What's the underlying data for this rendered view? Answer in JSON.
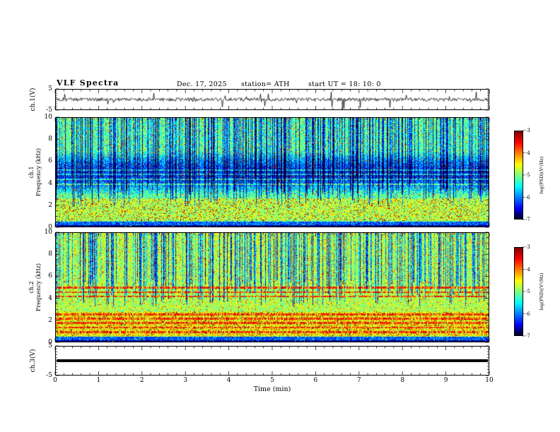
{
  "header": {
    "title": "VLF  Spectra",
    "date": "Dec. 17, 2025",
    "station": "station= ATH",
    "start_ut": "start UT  =   18: 10: 0"
  },
  "x_axis": {
    "label": "Time  (min)",
    "min": 0,
    "max": 10,
    "major_ticks": [
      0,
      1,
      2,
      3,
      4,
      5,
      6,
      7,
      8,
      9,
      10
    ],
    "minor_step": 0.2
  },
  "chart_data": [
    {
      "type": "line",
      "id": "ch1-waveform",
      "ylabel": "ch.1(V)",
      "ylim": [
        -5,
        5
      ],
      "ytick_labels": [
        5,
        -5
      ],
      "description": "Noisy channel-1 voltage trace, ~±1 V background with frequent impulsive sferic spikes reaching ±5 V",
      "seed": 7
    },
    {
      "type": "heatmap",
      "id": "ch1-spectrogram",
      "ylabel_lines": [
        "ch.1",
        "Frequency (kHz)"
      ],
      "ylim": [
        0,
        10
      ],
      "yticks": [
        0,
        2,
        4,
        6,
        8,
        10
      ],
      "colorbar": {
        "label": "log(PSD)(V²/Hz)",
        "ticks": [
          -3,
          -4,
          -5,
          -6,
          -7
        ],
        "min": -7,
        "max": -3
      },
      "features": {
        "background_psd": -4.9,
        "attenuation_band_khz": [
          2.9,
          6.9
        ],
        "vertical_sferic_streaks": "dense dark-blue vertical streaks spanning ~2-10 kHz",
        "dark_noise_floor_band_khz": [
          0,
          0.45
        ],
        "warm_band_khz": [
          0.5,
          2.6
        ],
        "faint_horizontal_lines_khz": [
          3.9,
          4.35,
          4.8,
          5.2
        ]
      },
      "seed": 11,
      "render": {
        "base": 0.47,
        "noise_amp": 0.3,
        "band_depth": 0.27,
        "streak_prob": 0.42,
        "streak_bot_min": 1.8,
        "streak_bot_rand": 2.8,
        "warm_amt": 0.1
      }
    },
    {
      "type": "heatmap",
      "id": "ch2-spectrogram",
      "ylabel_lines": [
        "ch.2",
        "Frequency (kHz)"
      ],
      "ylim": [
        0,
        10
      ],
      "yticks": [
        0,
        2,
        4,
        6,
        8,
        10
      ],
      "colorbar": {
        "label": "log(PSD)(V²/Hz)",
        "ticks": [
          -3,
          -4,
          -5,
          -6,
          -7
        ],
        "min": -7,
        "max": -3
      },
      "features": {
        "background_psd": -4.6,
        "vertical_sferic_streaks": "blue vertical streaks mostly above ~3.5 kHz",
        "hot_horizontal_lines_khz": [
          0.9,
          1.3,
          1.7,
          2.1,
          2.5,
          4.15,
          4.55,
          4.95
        ],
        "dark_noise_floor_band_khz": [
          0,
          0.45
        ],
        "warm_band_khz": [
          0.5,
          2.7
        ]
      },
      "seed": 23,
      "render": {
        "base": 0.56,
        "noise_amp": 0.28,
        "streak_prob": 0.36,
        "streak_bot_min": 3.2,
        "streak_bot_rand": 2.6,
        "warm_amt": 0.08
      }
    },
    {
      "type": "line",
      "id": "ch3-waveform",
      "ylabel": "ch.3(V)",
      "ylim": [
        -5,
        5
      ],
      "ytick_labels": [
        5,
        -5
      ],
      "constant_value": 0,
      "description": "Channel-3 trace flat at 0 V (thick black line)"
    }
  ]
}
